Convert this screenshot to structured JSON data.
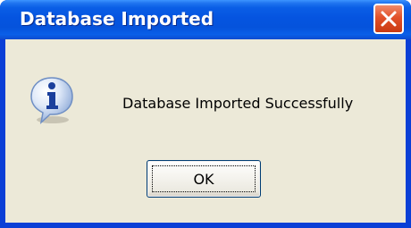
{
  "window": {
    "title": "Database Imported",
    "close_icon": "close-icon"
  },
  "dialog": {
    "icon": "info-icon",
    "message": "Database Imported Successfully",
    "ok_label": "OK"
  },
  "colors": {
    "titlebar": "#0554e0",
    "close_button": "#e2512a",
    "client_background": "#ece9d8",
    "button_border": "#003c74"
  }
}
